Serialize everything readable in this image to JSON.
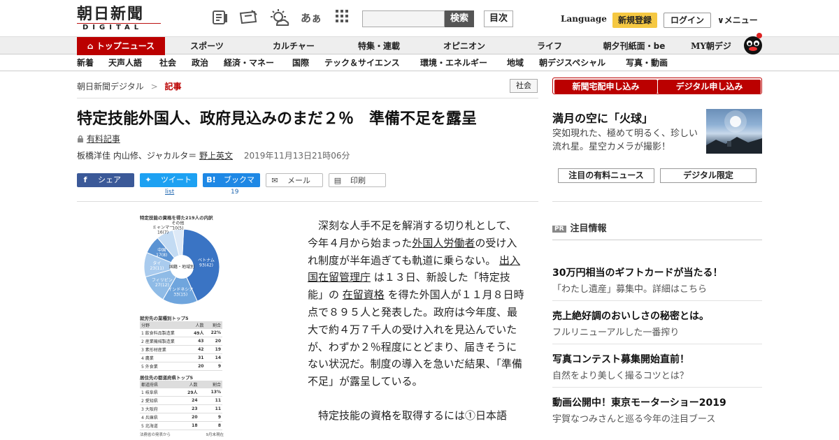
{
  "header": {
    "logo_text": "朝日新聞",
    "logo_sub": "DIGITAL",
    "aa_label": "あぁ",
    "search_placeholder": "",
    "search_button": "検索",
    "toc_button": "目次",
    "language": "Language",
    "register": "新規登録",
    "login": "ログイン",
    "menu": "メニュー"
  },
  "nav_primary": [
    "トップニュース",
    "スポーツ",
    "カルチャー",
    "特集・連載",
    "オピニオン",
    "ライフ",
    "朝夕刊紙面・be",
    "MY朝デジ"
  ],
  "nav_secondary": [
    "新着",
    "天声人語",
    "社会",
    "政治",
    "経済・マネー",
    "国際",
    "テック＆サイエンス",
    "環境・エネルギー",
    "地域",
    "朝デジスペシャル",
    "写真・動画"
  ],
  "breadcrumb": {
    "home": "朝日新聞デジタル",
    "sep": ">",
    "current": "記事"
  },
  "category_badge": "社会",
  "article": {
    "headline": "特定技能外国人、政府見込みのまだ２％　準備不足を露呈",
    "paid_label": "有料記事",
    "byline_authors": "板橋洋佳 内山修、ジャカルタ＝",
    "byline_link": "野上英文",
    "datetime": "2019年11月13日21時06分",
    "body_p1_a": "深刻な人手不足を解消する切り札として、今年４月から始まった",
    "body_link1": "外国人労働者",
    "body_p1_b": "の受け入れ制度が半年過ぎても軌道に乗らない。",
    "body_link2": "出入国在留管理庁",
    "body_p1_c": "は１３日、新設した「特定技能」の",
    "body_link3": "在留資格",
    "body_p1_d": "を得た外国人が１１月８日時点で８９５人と発表した。政府は今年度、最大で約４万７千人の受け入れを見込んでいたが、わずか２％程度にとどまり、届きそうにない状況だ。制度の導入を急いだ結果、「準備不足」が露呈している。",
    "body_p2": "特定技能の資格を取得するには①日本語"
  },
  "share": {
    "facebook": "シェア",
    "twitter": "ツイート",
    "twitter_count": "list",
    "hatena": "ブックマーク",
    "hatena_count": "19",
    "mail": "メール",
    "print": "印刷"
  },
  "infographic": {
    "title": "特定技能の資格を得た219人の内訳",
    "center_label": "国籍・地域別",
    "slices": [
      {
        "label": "ベトナム",
        "value": 93,
        "pct": "42%",
        "color": "#3a74c4"
      },
      {
        "label": "インドネシア",
        "value": 33,
        "pct": "15%",
        "color": "#6fa5dd"
      },
      {
        "label": "フィリピン",
        "value": 27,
        "pct": "12%",
        "color": "#8fbbe6"
      },
      {
        "label": "タイ",
        "value": 23,
        "pct": "11%",
        "color": "#a9cbee"
      },
      {
        "label": "中国",
        "value": 17,
        "pct": "8%",
        "color": "#5b93d3"
      },
      {
        "label": "ミャンマー",
        "value": 16,
        "pct": "7%",
        "color": "#c3dbf3"
      },
      {
        "label": "その他",
        "value": 10,
        "pct": "5%",
        "color": "#dde9f7"
      }
    ],
    "t1_title": "就労先の業種別トップ5",
    "t1_head": [
      "分野",
      "人数",
      "割合"
    ],
    "t1_rows": [
      [
        "1 飲食料品製造業",
        "49人",
        "22%"
      ],
      [
        "2 産業機械製造業",
        "43",
        "20"
      ],
      [
        "3 素形材産業",
        "42",
        "19"
      ],
      [
        "4 農業",
        "31",
        "14"
      ],
      [
        "5 外食業",
        "20",
        "9"
      ]
    ],
    "t2_title": "居住先の都道府県トップ5",
    "t2_head": [
      "都道府県",
      "人数",
      "割合"
    ],
    "t2_rows": [
      [
        "1 岐阜県",
        "29人",
        "13%"
      ],
      [
        "2 愛知県",
        "24",
        "11"
      ],
      [
        "3 大阪府",
        "23",
        "11"
      ],
      [
        "4 兵庫県",
        "20",
        "9"
      ],
      [
        "5 北海道",
        "18",
        "8"
      ]
    ],
    "source": "法務省の発表から",
    "as_of": "9月末現在"
  },
  "sidebar": {
    "btn_delivery": "新聞宅配申し込み",
    "btn_digital": "デジタル申し込み",
    "feature_title": "満月の空に「火球」",
    "feature_desc": "突如現れた、極めて明るく、珍しい流れ星。星空カメラが撮影！",
    "tab_paid": "注目の有料ニュース",
    "tab_digital": "デジタル限定",
    "notice_badge": "PR",
    "notice_head": "注目情報",
    "notices": [
      {
        "title": "30万円相当のギフトカードが当たる！",
        "desc": "「わたし遺産」募集中。詳細はこちら"
      },
      {
        "title": "売上絶好調のおいしさの秘密とは。",
        "desc": "フルリニューアルした一番搾り"
      },
      {
        "title": "写真コンテスト募集開始直前！",
        "desc": "自然をより美しく撮るコツとは？"
      },
      {
        "title": "動画公開中！東京モーターショー2019",
        "desc": "宇賀なつみさんと巡る今年の注目ブース"
      }
    ]
  }
}
